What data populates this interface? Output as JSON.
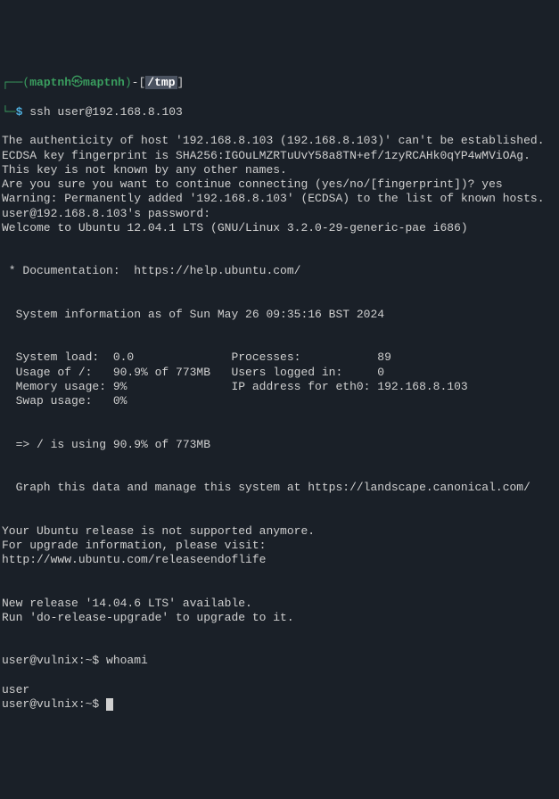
{
  "prompt1": {
    "open": "┌──(",
    "user": "maptnh",
    "at": "㉿",
    "host": "maptnh",
    "close": ")",
    "dash": "-",
    "lb": "[",
    "path": "/tmp",
    "rb": "]",
    "line2prefix": "└─",
    "dollar": "$",
    "command": " ssh user@192.168.8.103"
  },
  "out": {
    "l1": "The authenticity of host '192.168.8.103 (192.168.8.103)' can't be established.",
    "l2": "ECDSA key fingerprint is SHA256:IGOuLMZRTuUvY58a8TN+ef/1zyRCAHk0qYP4wMViOAg.",
    "l3": "This key is not known by any other names.",
    "l4": "Are you sure you want to continue connecting (yes/no/[fingerprint])? yes",
    "l5": "Warning: Permanently added '192.168.8.103' (ECDSA) to the list of known hosts.",
    "l6": "user@192.168.8.103's password:",
    "l7": "Welcome to Ubuntu 12.04.1 LTS (GNU/Linux 3.2.0-29-generic-pae i686)",
    "l8": " * Documentation:  https://help.ubuntu.com/",
    "l9": "  System information as of Sun May 26 09:35:16 BST 2024",
    "l10": "  System load:  0.0              Processes:           89",
    "l11": "  Usage of /:   90.9% of 773MB   Users logged in:     0",
    "l12": "  Memory usage: 9%               IP address for eth0: 192.168.8.103",
    "l13": "  Swap usage:   0%",
    "l14": "  => / is using 90.9% of 773MB",
    "l15": "  Graph this data and manage this system at https://landscape.canonical.com/",
    "l16": "Your Ubuntu release is not supported anymore.",
    "l17": "For upgrade information, please visit:",
    "l18": "http://www.ubuntu.com/releaseendoflife",
    "l19": "New release '14.04.6 LTS' available.",
    "l20": "Run 'do-release-upgrade' to upgrade to it."
  },
  "remote": {
    "prompt1": "user@vulnix:~$ ",
    "cmd1": "whoami",
    "result1": "user",
    "prompt2": "user@vulnix:~$ "
  }
}
